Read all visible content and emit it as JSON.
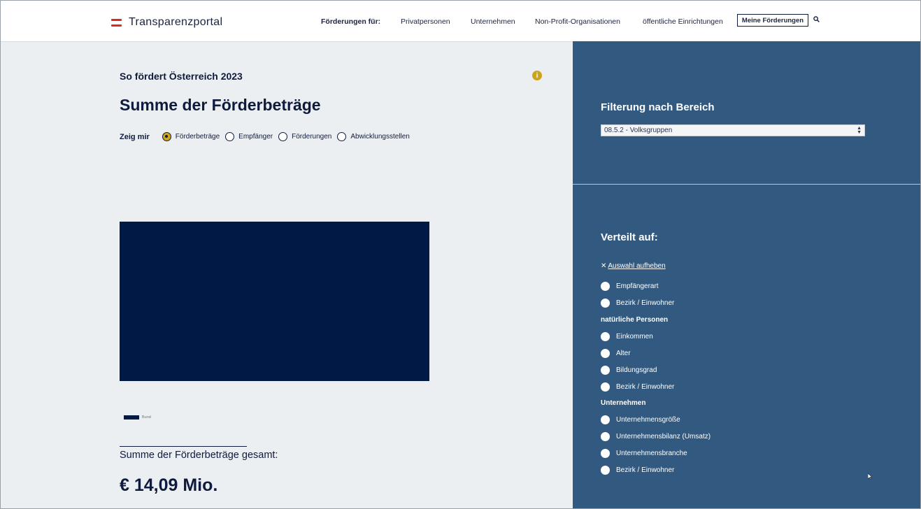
{
  "header": {
    "logo_text": "Transparenzportal",
    "nav_label": "Förderungen für:",
    "nav_items": [
      "Privatpersonen",
      "Unternehmen",
      "Non-Profit-Organisationen",
      "öffentliche Einrichtungen"
    ],
    "my_button": "Meine Förderungen",
    "search_icon": "search-icon",
    "flag_color": "#e3261f"
  },
  "main": {
    "subtitle": "So fördert Österreich 2023",
    "info_icon": "i",
    "title": "Summe der Förderbeträge",
    "show_label": "Zeig mir",
    "radios": [
      {
        "label": "Förderbeträge",
        "selected": true
      },
      {
        "label": "Empfänger",
        "selected": false
      },
      {
        "label": "Förderungen",
        "selected": false
      },
      {
        "label": "Abwicklungsstellen",
        "selected": false
      }
    ],
    "legend_label": "Bund",
    "total_label": "Summe der Förderbeträge gesamt:",
    "total_value": "€ 14,09 Mio."
  },
  "sidebar": {
    "filter_title": "Filterung nach Bereich",
    "filter_value": "08.5.2 - Volksgruppen",
    "distribution_title": "Verteilt auf:",
    "clear_label": "Auswahl aufheben",
    "options": [
      {
        "label": "Empfängerart"
      },
      {
        "label": "Bezirk / Einwohner"
      }
    ],
    "group_natural": "natürliche Personen",
    "natural_options": [
      {
        "label": "Einkommen"
      },
      {
        "label": "Alter"
      },
      {
        "label": "Bildungsgrad"
      },
      {
        "label": "Bezirk / Einwohner"
      }
    ],
    "group_companies": "Unternehmen",
    "company_options": [
      {
        "label": "Unternehmensgröße"
      },
      {
        "label": "Unternehmensbilanz (Umsatz)"
      },
      {
        "label": "Unternehmensbranche"
      },
      {
        "label": "Bezirk / Einwohner"
      }
    ],
    "bg_color": "#325a80"
  },
  "colors": {
    "accent": "#d0a51c",
    "dark_navy": "#001a45"
  }
}
